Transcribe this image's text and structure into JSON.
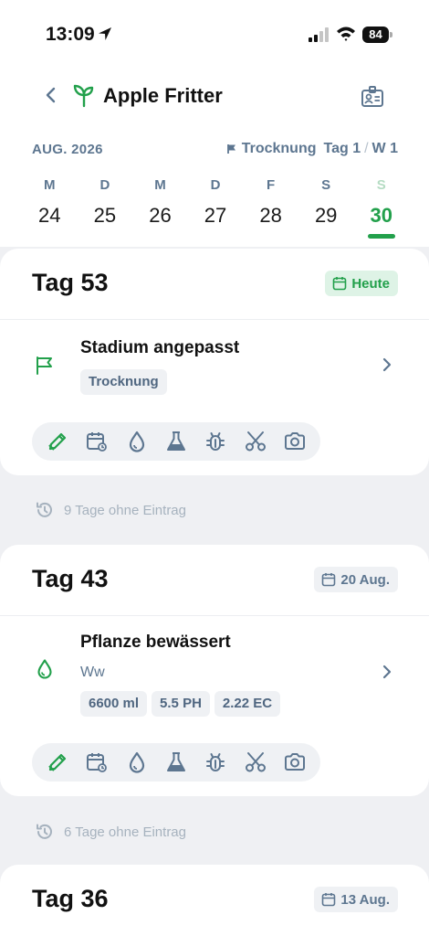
{
  "status": {
    "time": "13:09",
    "battery": "84"
  },
  "header": {
    "title": "Apple Fritter",
    "month": "AUG. 2026",
    "phase": {
      "name": "Trocknung",
      "day": "Tag 1",
      "week": "W 1"
    }
  },
  "week": [
    {
      "letter": "M",
      "num": "24"
    },
    {
      "letter": "D",
      "num": "25"
    },
    {
      "letter": "M",
      "num": "26"
    },
    {
      "letter": "D",
      "num": "27"
    },
    {
      "letter": "F",
      "num": "28"
    },
    {
      "letter": "S",
      "num": "29"
    },
    {
      "letter": "S",
      "num": "30",
      "selected": true
    }
  ],
  "days": [
    {
      "title": "Tag 53",
      "date": "Heute",
      "entry": {
        "title": "Stadium angepasst",
        "chips": [
          "Trocknung"
        ]
      },
      "gap": "9 Tage ohne Eintrag"
    },
    {
      "title": "Tag 43",
      "date": "20 Aug.",
      "entry": {
        "title": "Pflanze bewässert",
        "subtitle": "Ww",
        "chips": [
          "6600 ml",
          "5.5 PH",
          "2.22 EC"
        ]
      },
      "gap": "6 Tage ohne Eintrag"
    },
    {
      "title": "Tag 36",
      "date": "13 Aug."
    }
  ],
  "toolbar": [
    "edit-icon",
    "calendar-repeat-icon",
    "water-drop-icon",
    "flask-icon",
    "bug-icon",
    "scissors-icon",
    "camera-icon"
  ],
  "colors": {
    "accent": "#22a04b",
    "muted": "#5d7690",
    "background": "#eff0f3"
  }
}
